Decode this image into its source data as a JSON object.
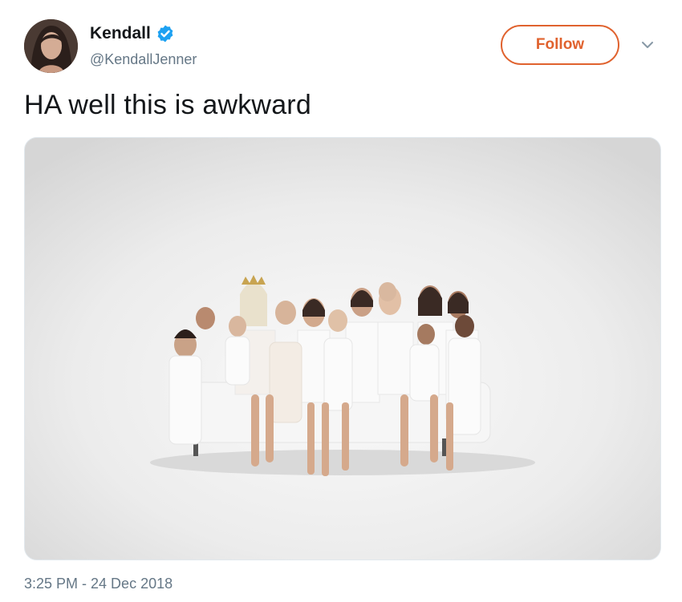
{
  "user": {
    "display_name": "Kendall",
    "handle": "@KendallJenner",
    "verified": true
  },
  "actions": {
    "follow_label": "Follow"
  },
  "tweet": {
    "text": "HA well this is awkward",
    "timestamp": "3:25 PM - 24 Dec 2018"
  },
  "colors": {
    "follow_accent": "#e0622e",
    "verified_blue": "#1da1f2",
    "secondary_text": "#657786",
    "primary_text": "#14171a"
  },
  "icons": {
    "verified": "verified-badge-icon",
    "caret": "chevron-down-icon"
  }
}
